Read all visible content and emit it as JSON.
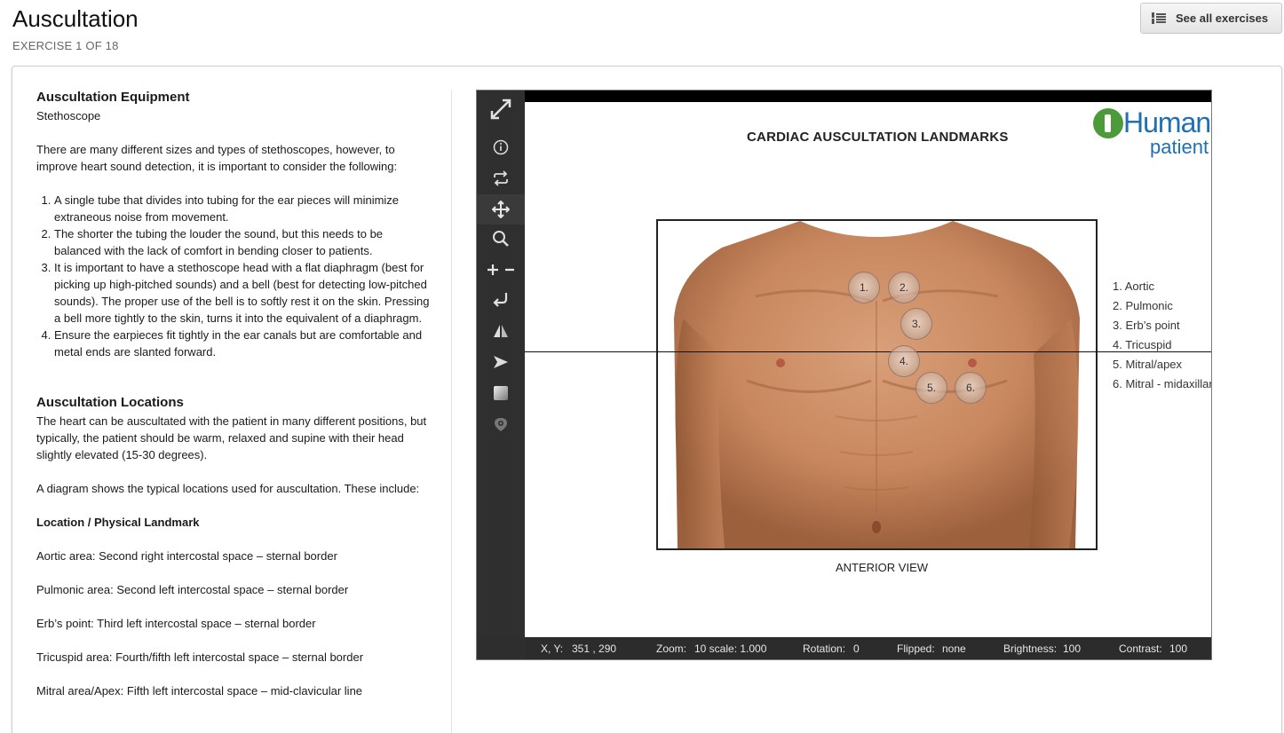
{
  "page": {
    "title": "Auscultation",
    "subtitle": "EXERCISE 1 OF 18",
    "see_all_label": "See all exercises"
  },
  "content": {
    "equipment_heading": "Auscultation Equipment",
    "equipment_sub": "Stethoscope",
    "intro": "There are many different sizes and types of stethoscopes, however, to improve heart sound detection, it is important to consider the following:",
    "list": [
      "A single tube that divides into tubing for the ear pieces will minimize extraneous noise from movement.",
      "The shorter the tubing the louder the sound, but this needs to be balanced with the lack of comfort in bending closer to patients.",
      "It is important to have a stethoscope head with a flat diaphragm (best for picking up high-pitched sounds) and a bell (best for detecting low-pitched sounds). The proper use of the bell is to softly rest it on the skin. Pressing a bell more tightly to the skin, turns it into the equivalent of a diaphragm.",
      "Ensure the earpieces fit tightly in the ear canals but are comfortable and metal ends are slanted forward."
    ],
    "locations_heading": "Auscultation Locations",
    "locations_p1": "The heart can be auscultated with the patient in many different positions, but typically, the patient should be warm, relaxed and supine with their head slightly elevated (15-30 degrees).",
    "locations_p2": "A diagram shows the typical locations used for auscultation. These include:",
    "table_heading": "Location / Physical Landmark",
    "locations": [
      "Aortic area: Second right intercostal space – sternal border",
      "Pulmonic area: Second left intercostal space – sternal border",
      "Erb’s point: Third left intercostal space – sternal border",
      "Tricuspid area: Fourth/fifth left intercostal space – sternal border",
      "Mitral area/Apex: Fifth left intercostal space – mid-clavicular line"
    ]
  },
  "viewer": {
    "tools": [
      "fullscreen-icon",
      "info-icon",
      "reset-icon",
      "pan-icon",
      "zoom-icon",
      "zoom-in-out-icon",
      "rotate-icon",
      "flip-icon",
      "brightness-icon",
      "contrast-icon",
      "eye-icon"
    ],
    "diagram_title": "CARDIAC AUSCULTATION LANDMARKS",
    "logo_text1": "Human",
    "logo_text2": "patient",
    "view_label": "ANTERIOR VIEW",
    "markers": [
      "1.",
      "2.",
      "3.",
      "4.",
      "5.",
      "6."
    ],
    "legend": [
      "1. Aortic",
      "2. Pulmonic",
      "3. Erb’s point",
      "4. Tricuspid",
      "5. Mitral/apex",
      "6. Mitral - midaxillar"
    ],
    "status": {
      "xy_label": "X, Y:",
      "xy_value": "351 ,  290",
      "zoom_label": "Zoom:",
      "zoom_value": "10 scale: 1.000",
      "rotation_label": "Rotation:",
      "rotation_value": "0",
      "flipped_label": "Flipped:",
      "flipped_value": "none",
      "brightness_label": "Brightness:",
      "brightness_value": "100",
      "contrast_label": "Contrast:",
      "contrast_value": "100"
    }
  }
}
